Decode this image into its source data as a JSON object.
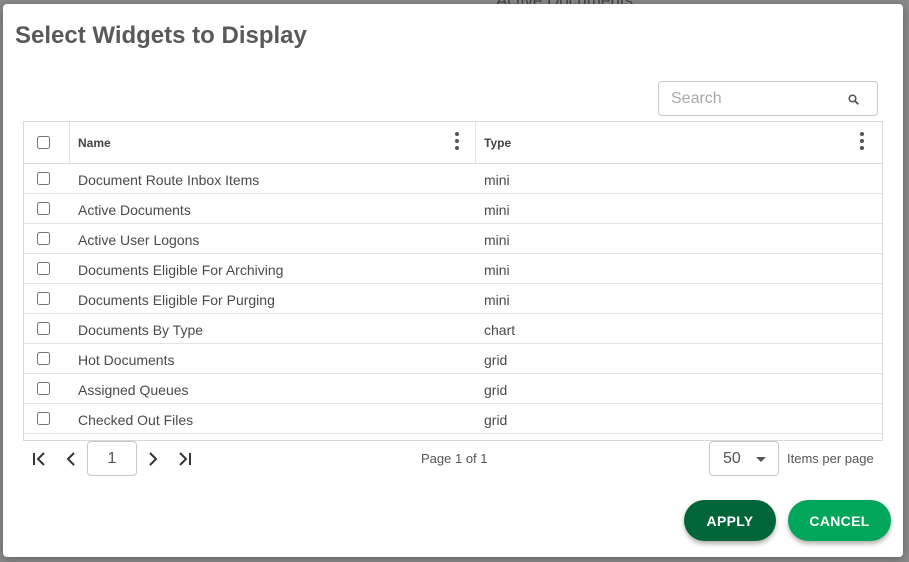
{
  "background": {
    "partial_title": "Active Documents"
  },
  "dialog": {
    "title": "Select Widgets to Display",
    "search": {
      "placeholder": "Search",
      "value": ""
    },
    "columns": {
      "name": "Name",
      "type": "Type"
    },
    "rows": [
      {
        "name": "Document Route Inbox Items",
        "type": "mini"
      },
      {
        "name": "Active Documents",
        "type": "mini"
      },
      {
        "name": "Active User Logons",
        "type": "mini"
      },
      {
        "name": "Documents Eligible For Archiving",
        "type": "mini"
      },
      {
        "name": "Documents Eligible For Purging",
        "type": "mini"
      },
      {
        "name": "Documents By Type",
        "type": "chart"
      },
      {
        "name": "Hot Documents",
        "type": "grid"
      },
      {
        "name": "Assigned Queues",
        "type": "grid"
      },
      {
        "name": "Checked Out Files",
        "type": "grid"
      }
    ],
    "pager": {
      "current_page": "1",
      "page_info": "Page 1 of 1",
      "page_size": "50",
      "page_size_label": "Items per page"
    },
    "buttons": {
      "apply": "APPLY",
      "cancel": "CANCEL"
    },
    "colors": {
      "apply": "#00663a",
      "cancel": "#00a659",
      "title": "#595959"
    }
  }
}
